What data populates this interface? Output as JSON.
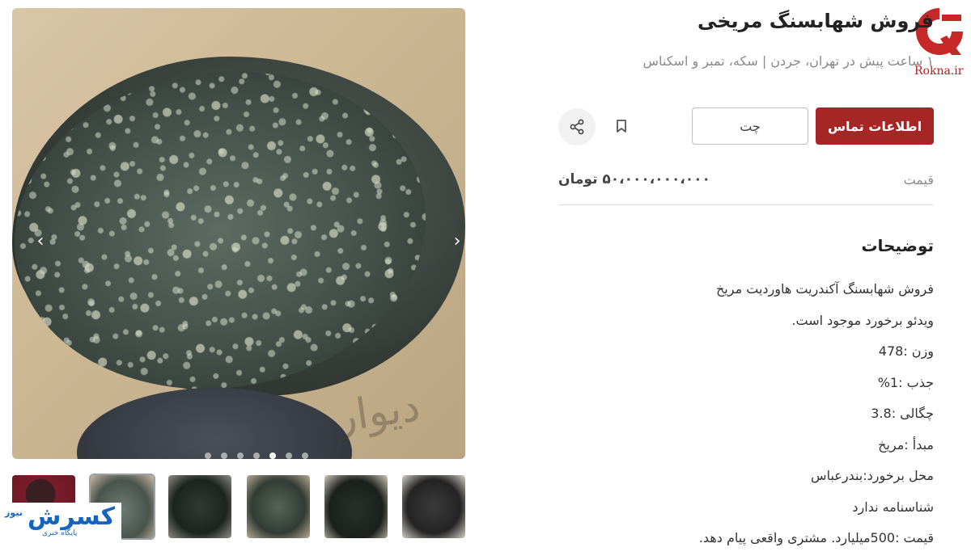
{
  "gallery": {
    "watermark": "دیوار",
    "dot_count": 7,
    "active_dot": 3,
    "thumbnail_count": 6,
    "active_thumbnail": 2
  },
  "brand_logo": {
    "main": "کسرش",
    "tiny": "نیوز",
    "tagline": "پایگاه خبری"
  },
  "listing": {
    "title": "فروش شهابسنگ مریخی",
    "subtitle": "۱ ساعت پیش در تهران، جردن | سکه، تمبر و اسکناس"
  },
  "rokna": {
    "label": "Rokna.ir"
  },
  "actions": {
    "contact_label": "اطلاعات تماس",
    "chat_label": "چت"
  },
  "price": {
    "label": "قیمت",
    "value": "۵۰،۰۰۰،۰۰۰،۰۰۰ تومان"
  },
  "description": {
    "heading": "توضیحات",
    "lines": [
      "فروش شهابسنگ آکندریت هاوردیت مریخ",
      "ویدئو برخورد موجود است.",
      "وزن :478",
      "جذب :1%",
      "چگالی :3.8",
      "مبدأ :مریخ",
      "محل برخورد:بندرعباس",
      "شناسنامه ندارد",
      "قیمت :500میلیارد. مشتری واقعی پیام دهد."
    ]
  },
  "colors": {
    "accent": "#a62626",
    "brand_blue": "#1565c0",
    "rokna_red": "#b71c1c"
  }
}
